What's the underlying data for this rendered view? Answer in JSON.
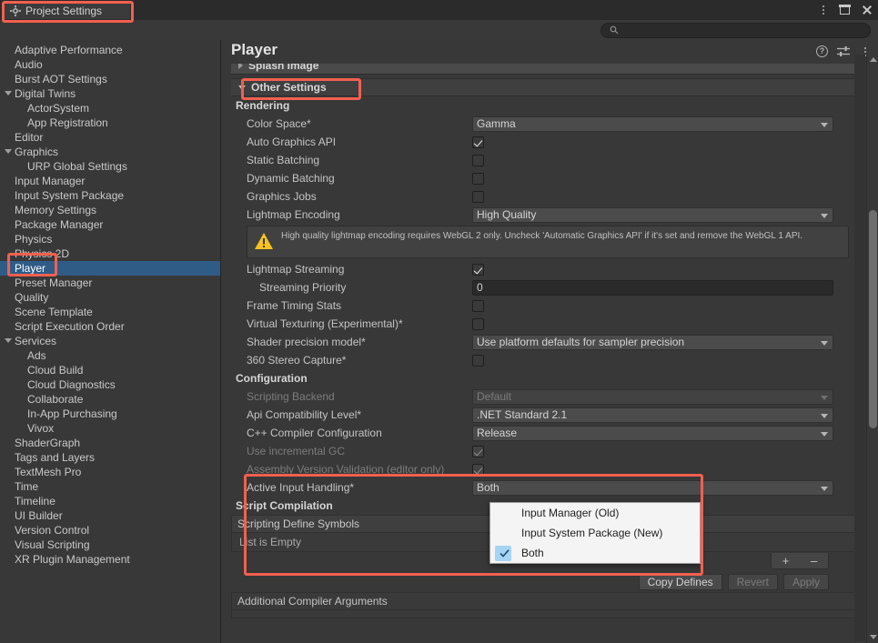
{
  "window": {
    "tab_label": "Project Settings",
    "tab_icon": "gear-icon",
    "buttons": {
      "menu": "kebab-menu-icon",
      "maximize": "maximize-icon",
      "close": "close-icon"
    }
  },
  "search": {
    "placeholder": "",
    "value": "",
    "icon": "search-icon"
  },
  "sidebar": {
    "items": [
      {
        "label": "Adaptive Performance",
        "indent": false,
        "expandable": false,
        "selected": false
      },
      {
        "label": "Audio",
        "indent": false,
        "expandable": false,
        "selected": false
      },
      {
        "label": "Burst AOT Settings",
        "indent": false,
        "expandable": false,
        "selected": false
      },
      {
        "label": "Digital Twins",
        "indent": false,
        "expandable": true,
        "selected": false
      },
      {
        "label": "ActorSystem",
        "indent": true,
        "expandable": false,
        "selected": false
      },
      {
        "label": "App Registration",
        "indent": true,
        "expandable": false,
        "selected": false
      },
      {
        "label": "Editor",
        "indent": false,
        "expandable": false,
        "selected": false
      },
      {
        "label": "Graphics",
        "indent": false,
        "expandable": true,
        "selected": false
      },
      {
        "label": "URP Global Settings",
        "indent": true,
        "expandable": false,
        "selected": false
      },
      {
        "label": "Input Manager",
        "indent": false,
        "expandable": false,
        "selected": false
      },
      {
        "label": "Input System Package",
        "indent": false,
        "expandable": false,
        "selected": false
      },
      {
        "label": "Memory Settings",
        "indent": false,
        "expandable": false,
        "selected": false
      },
      {
        "label": "Package Manager",
        "indent": false,
        "expandable": false,
        "selected": false
      },
      {
        "label": "Physics",
        "indent": false,
        "expandable": false,
        "selected": false
      },
      {
        "label": "Physics 2D",
        "indent": false,
        "expandable": false,
        "selected": false
      },
      {
        "label": "Player",
        "indent": false,
        "expandable": false,
        "selected": true
      },
      {
        "label": "Preset Manager",
        "indent": false,
        "expandable": false,
        "selected": false
      },
      {
        "label": "Quality",
        "indent": false,
        "expandable": false,
        "selected": false
      },
      {
        "label": "Scene Template",
        "indent": false,
        "expandable": false,
        "selected": false
      },
      {
        "label": "Script Execution Order",
        "indent": false,
        "expandable": false,
        "selected": false
      },
      {
        "label": "Services",
        "indent": false,
        "expandable": true,
        "selected": false
      },
      {
        "label": "Ads",
        "indent": true,
        "expandable": false,
        "selected": false
      },
      {
        "label": "Cloud Build",
        "indent": true,
        "expandable": false,
        "selected": false
      },
      {
        "label": "Cloud Diagnostics",
        "indent": true,
        "expandable": false,
        "selected": false
      },
      {
        "label": "Collaborate",
        "indent": true,
        "expandable": false,
        "selected": false
      },
      {
        "label": "In-App Purchasing",
        "indent": true,
        "expandable": false,
        "selected": false
      },
      {
        "label": "Vivox",
        "indent": true,
        "expandable": false,
        "selected": false
      },
      {
        "label": "ShaderGraph",
        "indent": false,
        "expandable": false,
        "selected": false
      },
      {
        "label": "Tags and Layers",
        "indent": false,
        "expandable": false,
        "selected": false
      },
      {
        "label": "TextMesh Pro",
        "indent": false,
        "expandable": false,
        "selected": false
      },
      {
        "label": "Time",
        "indent": false,
        "expandable": false,
        "selected": false
      },
      {
        "label": "Timeline",
        "indent": false,
        "expandable": false,
        "selected": false
      },
      {
        "label": "UI Builder",
        "indent": false,
        "expandable": false,
        "selected": false
      },
      {
        "label": "Version Control",
        "indent": false,
        "expandable": false,
        "selected": false
      },
      {
        "label": "Visual Scripting",
        "indent": false,
        "expandable": false,
        "selected": false
      },
      {
        "label": "XR Plugin Management",
        "indent": false,
        "expandable": false,
        "selected": false
      }
    ]
  },
  "pane": {
    "title": "Player",
    "icons": {
      "help": "help-icon",
      "preset": "preset-settings-icon",
      "menu": "kebab-menu-icon"
    },
    "splash_foldout": "Splash Image",
    "other_settings_foldout": "Other Settings",
    "groups": {
      "rendering": "Rendering",
      "configuration": "Configuration",
      "script_compilation": "Script Compilation"
    },
    "rendering_rows": [
      {
        "label": "Color Space*",
        "type": "dropdown",
        "value": "Gamma",
        "indent": 0,
        "disabled": false
      },
      {
        "label": "Auto Graphics API",
        "type": "checkbox",
        "checked": true,
        "indent": 0,
        "disabled": false
      },
      {
        "label": "Static Batching",
        "type": "checkbox",
        "checked": false,
        "indent": 0,
        "disabled": false
      },
      {
        "label": "Dynamic Batching",
        "type": "checkbox",
        "checked": false,
        "indent": 0,
        "disabled": false
      },
      {
        "label": "Graphics Jobs",
        "type": "checkbox",
        "checked": false,
        "indent": 0,
        "disabled": false
      },
      {
        "label": "Lightmap Encoding",
        "type": "dropdown",
        "value": "High Quality",
        "indent": 0,
        "disabled": false
      }
    ],
    "warning": {
      "icon": "warning-icon",
      "text": "High quality lightmap encoding requires WebGL 2 only. Uncheck 'Automatic Graphics API' if it's set and remove the WebGL 1 API."
    },
    "rendering_rows_2": [
      {
        "label": "Lightmap Streaming",
        "type": "checkbox",
        "checked": true,
        "indent": 0,
        "disabled": false
      },
      {
        "label": "Streaming Priority",
        "type": "number",
        "value": "0",
        "indent": 1,
        "disabled": false
      },
      {
        "label": "Frame Timing Stats",
        "type": "checkbox",
        "checked": false,
        "indent": 0,
        "disabled": false
      },
      {
        "label": "Virtual Texturing (Experimental)*",
        "type": "checkbox",
        "checked": false,
        "indent": 0,
        "disabled": false
      },
      {
        "label": "Shader precision model*",
        "type": "dropdown",
        "value": "Use platform defaults for sampler precision",
        "indent": 0,
        "disabled": false
      },
      {
        "label": "360 Stereo Capture*",
        "type": "checkbox",
        "checked": false,
        "indent": 0,
        "disabled": false
      }
    ],
    "configuration_rows": [
      {
        "label": "Scripting Backend",
        "type": "dropdown",
        "value": "Default",
        "indent": 0,
        "disabled": true
      },
      {
        "label": "Api Compatibility Level*",
        "type": "dropdown",
        "value": ".NET Standard 2.1",
        "indent": 0,
        "disabled": false
      },
      {
        "label": "C++ Compiler Configuration",
        "type": "dropdown",
        "value": "Release",
        "indent": 0,
        "disabled": false
      },
      {
        "label": "Use incremental GC",
        "type": "checkbox",
        "checked": true,
        "indent": 0,
        "disabled": true
      },
      {
        "label": "Assembly Version Validation (editor only)",
        "type": "checkbox",
        "checked": true,
        "indent": 0,
        "disabled": true
      },
      {
        "label": "Active Input Handling*",
        "type": "dropdown",
        "value": "Both",
        "indent": 0,
        "disabled": false
      }
    ],
    "script_compilation": {
      "list_header": "Scripting Define Symbols",
      "list_empty": "List is Empty",
      "add_button": "+",
      "remove_button": "–",
      "copy_defines": "Copy Defines",
      "revert": "Revert",
      "apply": "Apply",
      "additional_args_header": "Additional Compiler Arguments"
    }
  },
  "dropdown_popup": {
    "open_for": "Active Input Handling*",
    "options": [
      {
        "label": "Input Manager (Old)",
        "checked": false
      },
      {
        "label": "Input System Package (New)",
        "checked": false
      },
      {
        "label": "Both",
        "checked": true
      }
    ]
  },
  "annotations": {
    "highlight_color": "#f2604f",
    "boxes": [
      "project-settings-tab",
      "player-sidebar-item",
      "other-settings-foldout",
      "active-input-handling-area"
    ]
  },
  "colors": {
    "background": "#383838",
    "panel": "#3f3f3f",
    "selection_blue": "#2f5c87",
    "popup_highlight": "#a6d4f5",
    "warning_yellow": "#f5c21f",
    "annotation_red": "#f2604f"
  }
}
